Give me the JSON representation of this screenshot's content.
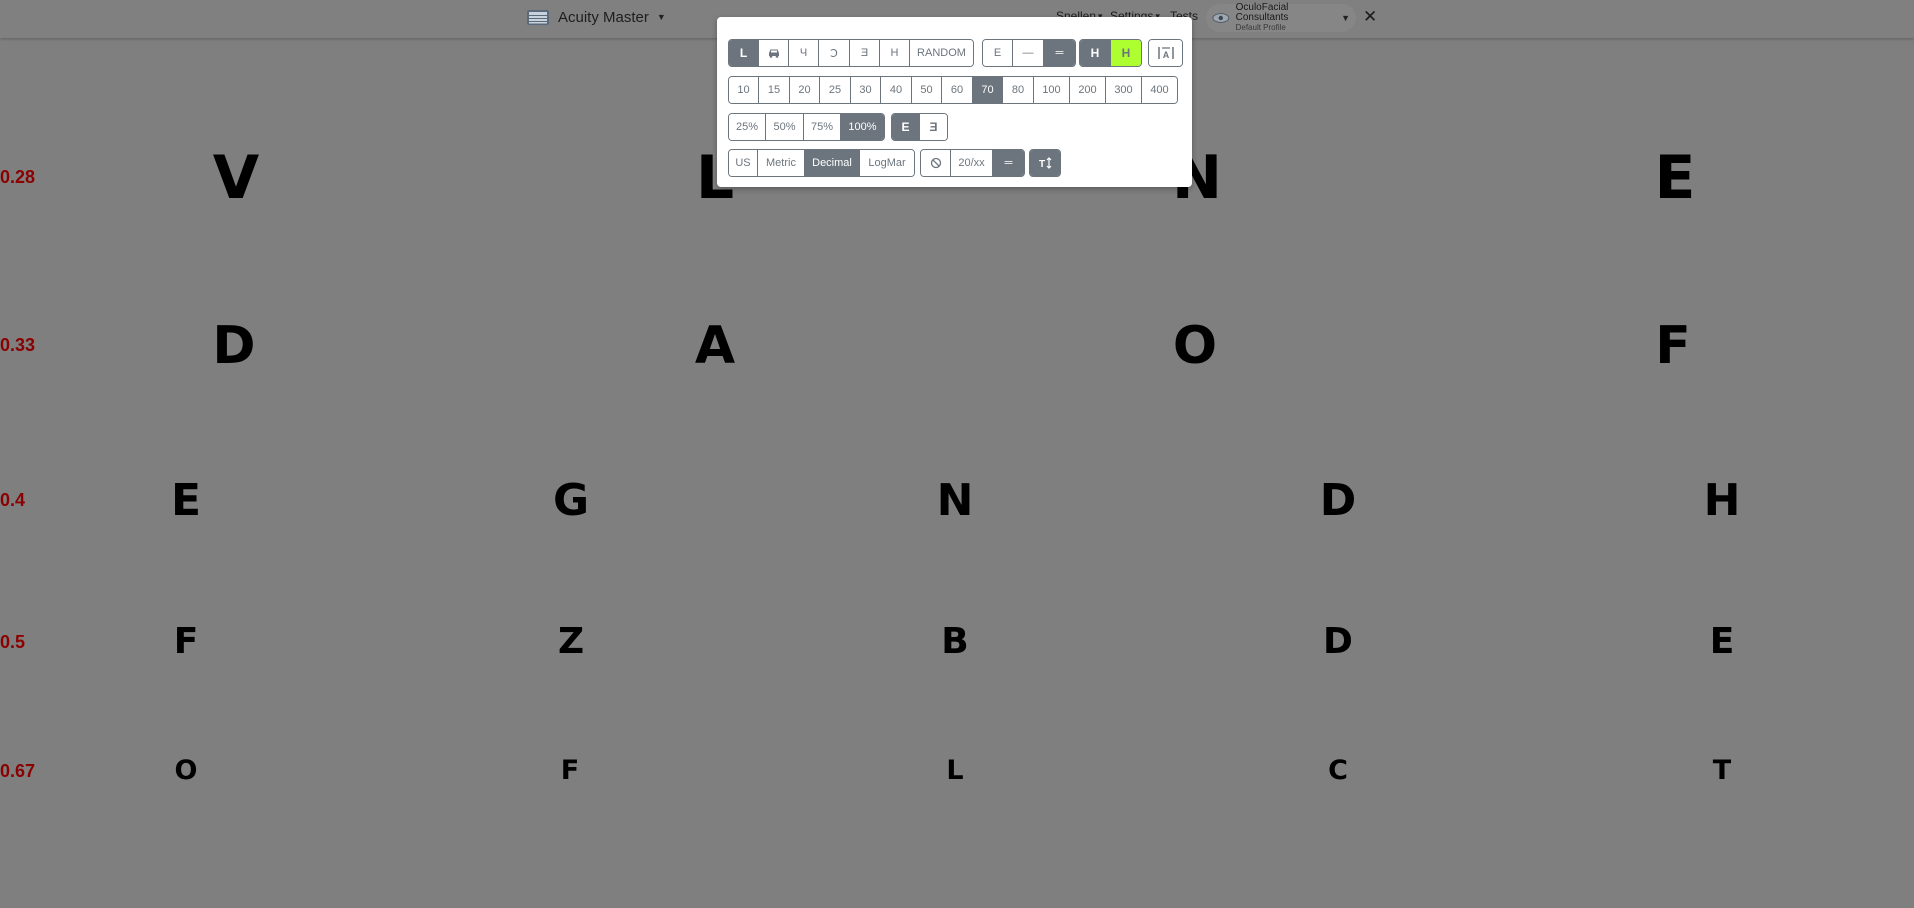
{
  "app": {
    "title": "Acuity Master",
    "logo_icon": "acuity-master-logo",
    "nav": [
      {
        "label": "Snellen"
      },
      {
        "label": "Settings"
      },
      {
        "label": "Tests"
      }
    ],
    "profile": {
      "name": "OculoFacial Consultants",
      "subtitle": "Default Profile"
    },
    "close_label": "✕"
  },
  "panel": {
    "chart_types": [
      {
        "label": "L",
        "icon": "letters",
        "active": true
      },
      {
        "label": "",
        "icon": "car-icon",
        "active": false
      },
      {
        "label": "Ч",
        "icon": "numbers",
        "active": false
      },
      {
        "label": "Ↄ",
        "icon": "landolt-c",
        "active": false
      },
      {
        "label": "Ǝ",
        "icon": "tumbling-e",
        "active": false
      },
      {
        "label": "H",
        "icon": "hotv",
        "active": false
      },
      {
        "label": "RANDOM",
        "icon": "",
        "active": false
      }
    ],
    "line_modes": [
      {
        "label": "E",
        "active": false
      },
      {
        "label": "—",
        "active": false
      },
      {
        "label": "═",
        "active": true
      }
    ],
    "color_modes": [
      {
        "label": "H",
        "active": true,
        "color": "#6c757d"
      },
      {
        "label": "H",
        "active": false,
        "color": "#adff2f"
      }
    ],
    "crowding_icon": "crowding-bar-icon",
    "sizes": [
      {
        "label": "10",
        "active": false
      },
      {
        "label": "15",
        "active": false
      },
      {
        "label": "20",
        "active": false
      },
      {
        "label": "25",
        "active": false
      },
      {
        "label": "30",
        "active": false
      },
      {
        "label": "40",
        "active": false
      },
      {
        "label": "50",
        "active": false
      },
      {
        "label": "60",
        "active": false
      },
      {
        "label": "70",
        "active": true
      },
      {
        "label": "80",
        "active": false
      },
      {
        "label": "100",
        "active": false
      },
      {
        "label": "200",
        "active": false
      },
      {
        "label": "300",
        "active": false
      },
      {
        "label": "400",
        "active": false
      }
    ],
    "contrast": [
      {
        "label": "25%",
        "active": false
      },
      {
        "label": "50%",
        "active": false
      },
      {
        "label": "75%",
        "active": false
      },
      {
        "label": "100%",
        "active": true
      }
    ],
    "mirror": [
      {
        "label": "E",
        "active": true
      },
      {
        "label": "Ǝ",
        "active": false
      }
    ],
    "notation": [
      {
        "label": "US",
        "active": false
      },
      {
        "label": "Metric",
        "active": false
      },
      {
        "label": "Decimal",
        "active": true
      },
      {
        "label": "LogMar",
        "active": false
      }
    ],
    "display_opts": [
      {
        "label": "⃠",
        "icon": "hide-icon",
        "active": false
      },
      {
        "label": "20/xx",
        "icon": "",
        "active": false
      },
      {
        "label": "═",
        "icon": "",
        "active": true
      }
    ],
    "sort_icon": "sort-vertical-icon"
  },
  "chart_rows": [
    {
      "label": "0.28",
      "letters": [
        "V",
        "L",
        "N",
        "E"
      ]
    },
    {
      "label": "0.33",
      "letters": [
        "D",
        "A",
        "O",
        "F"
      ]
    },
    {
      "label": "0.4",
      "letters": [
        "E",
        "G",
        "N",
        "D",
        "H"
      ]
    },
    {
      "label": "0.5",
      "letters": [
        "F",
        "Z",
        "B",
        "D",
        "E"
      ]
    },
    {
      "label": "0.67",
      "letters": [
        "O",
        "F",
        "L",
        "C",
        "T"
      ]
    }
  ],
  "colors": {
    "background": "#7f7f7f",
    "row_label": "#8b0000",
    "accent": "#6c757d",
    "highlight": "#adff2f"
  }
}
